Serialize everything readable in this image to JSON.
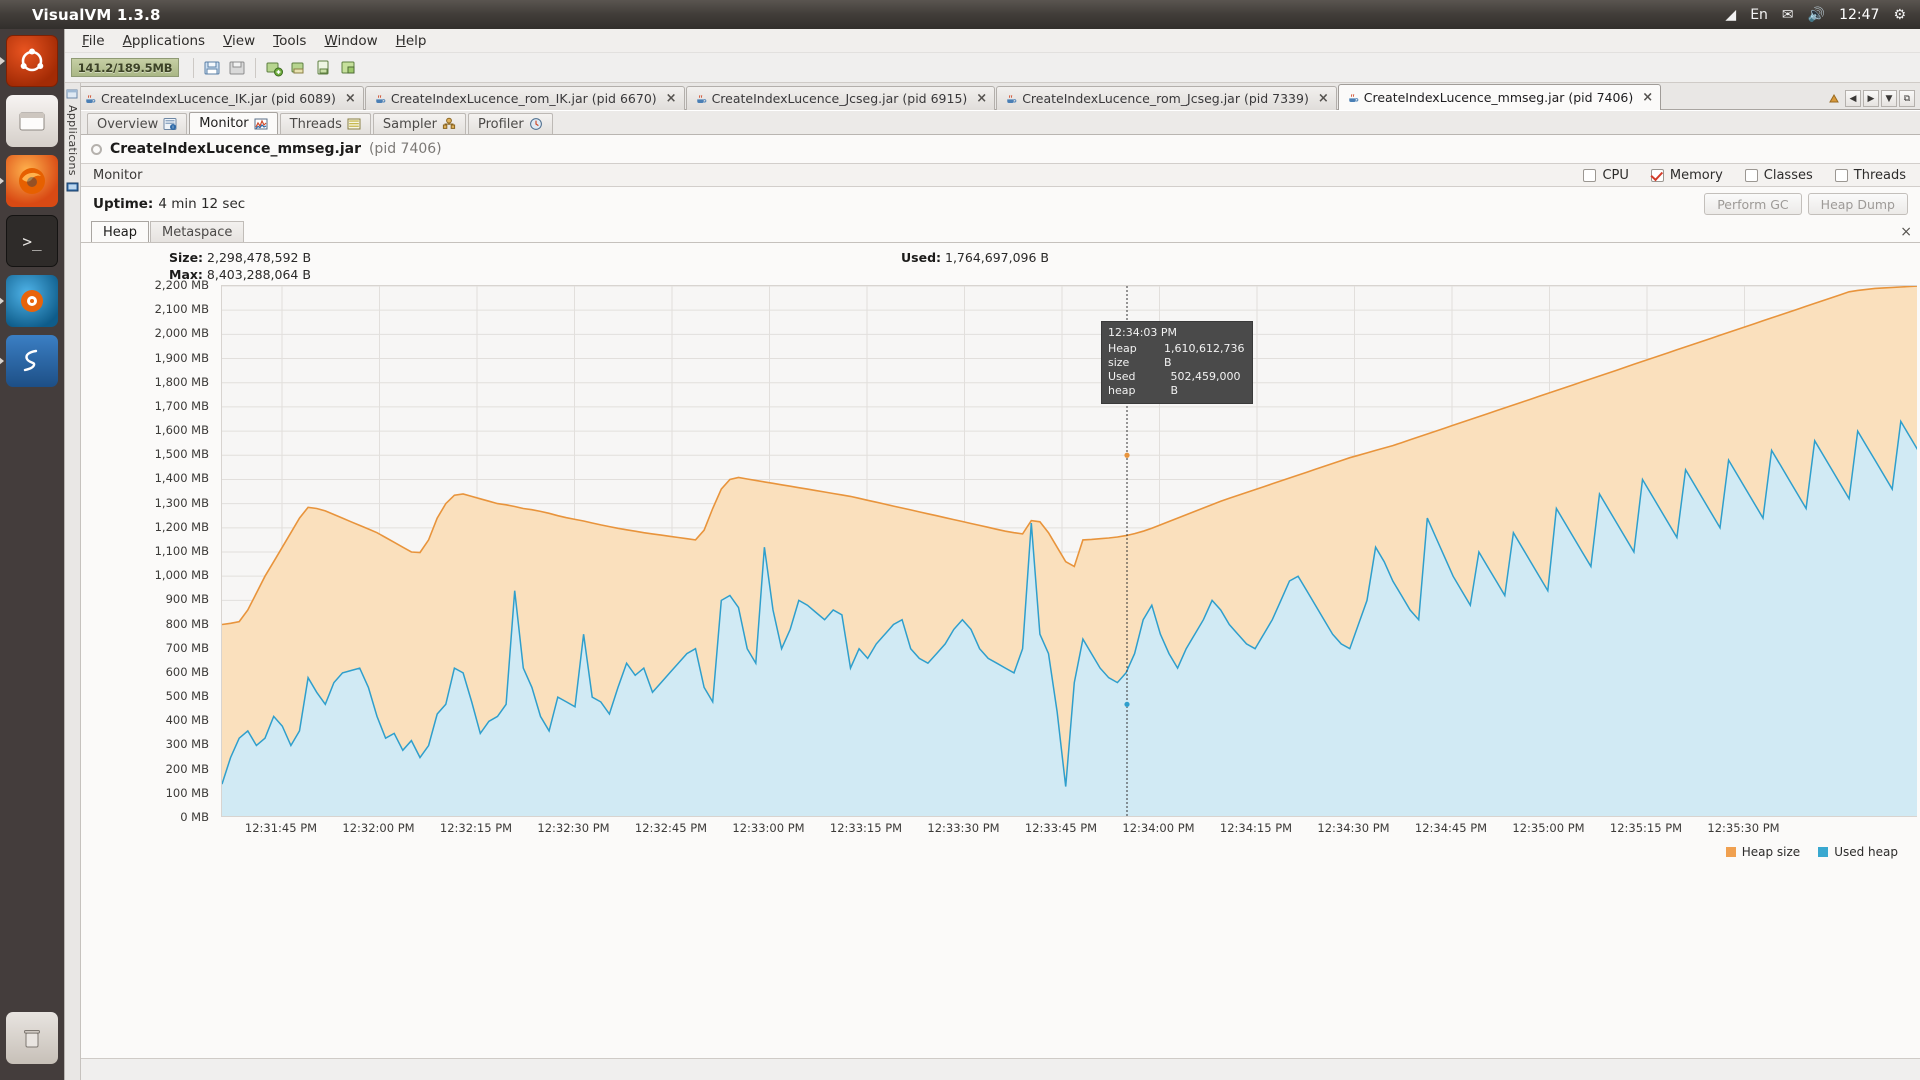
{
  "desktop": {
    "title": "VisualVM 1.3.8",
    "clock": "12:47",
    "indicators": [
      "wifi-icon",
      "En",
      "mail-icon",
      "volume-icon"
    ],
    "launcher": [
      {
        "name": "ubuntu-dash",
        "glyph": "●"
      },
      {
        "name": "files",
        "glyph": "▤"
      },
      {
        "name": "firefox",
        "glyph": "◑"
      },
      {
        "name": "terminal",
        "glyph": "$_"
      },
      {
        "name": "amarok",
        "glyph": "♫"
      },
      {
        "name": "java-app",
        "glyph": "☕"
      },
      {
        "name": "visualvm",
        "glyph": "S"
      },
      {
        "name": "trash",
        "glyph": "🗑"
      }
    ]
  },
  "menu": [
    {
      "label": "File",
      "mnemonic": "F"
    },
    {
      "label": "Applications",
      "mnemonic": "A"
    },
    {
      "label": "View",
      "mnemonic": "V"
    },
    {
      "label": "Tools",
      "mnemonic": "T"
    },
    {
      "label": "Window",
      "mnemonic": "W"
    },
    {
      "label": "Help",
      "mnemonic": "H"
    }
  ],
  "toolbar": {
    "heap_meter": "141.2/189.5MB",
    "buttons": [
      {
        "name": "open-file-button",
        "icon": "folder-open-icon"
      },
      {
        "name": "save-button",
        "icon": "floppy-icon"
      },
      {
        "name": "add-jmx-connection-button",
        "icon": "add-connection-icon"
      },
      {
        "name": "add-remote-host-button",
        "icon": "add-jmx-icon"
      },
      {
        "name": "add-snapshot-button",
        "icon": "add-snapshot-icon"
      },
      {
        "name": "add-app-button",
        "icon": "add-app-icon"
      }
    ]
  },
  "tabs": [
    {
      "label": "CreateIndexLucence_IK.jar (pid 6089)",
      "active": false,
      "closable": true
    },
    {
      "label": "CreateIndexLucence_rom_IK.jar (pid 6670)",
      "active": false,
      "closable": true
    },
    {
      "label": "CreateIndexLucence_Jcseg.jar (pid 6915)",
      "active": false,
      "closable": true
    },
    {
      "label": "CreateIndexLucence_rom_Jcseg.jar (pid 7339)",
      "active": false,
      "closable": true
    },
    {
      "label": "CreateIndexLucence_mmseg.jar (pid 7406)",
      "active": true,
      "closable": true
    }
  ],
  "tab_nav": {
    "scroll_left": "◀",
    "scroll_right": "▶",
    "dropdown": "▼",
    "maximize": "⧉"
  },
  "dock": {
    "label": "Applications",
    "icons": [
      "applications-window-icon",
      "monitor-icon"
    ]
  },
  "subtabs": [
    {
      "label": "Overview",
      "icon": "overview-icon",
      "active": false
    },
    {
      "label": "Monitor",
      "icon": "monitor-chart-icon",
      "active": true
    },
    {
      "label": "Threads",
      "icon": "threads-icon",
      "active": false
    },
    {
      "label": "Sampler",
      "icon": "sampler-icon",
      "active": false
    },
    {
      "label": "Profiler",
      "icon": "profiler-clock-icon",
      "active": false
    }
  ],
  "app_header": {
    "name": "CreateIndexLucence_mmseg.jar",
    "pid": "(pid 7406)"
  },
  "monitor_bar": {
    "title": "Monitor",
    "checkboxes": [
      {
        "label": "CPU",
        "checked": false
      },
      {
        "label": "Memory",
        "checked": true
      },
      {
        "label": "Classes",
        "checked": false
      },
      {
        "label": "Threads",
        "checked": false
      }
    ]
  },
  "uptime": {
    "label": "Uptime:",
    "value": "4 min 12 sec",
    "perform_gc": "Perform GC",
    "heap_dump": "Heap Dump"
  },
  "memory_tabs": [
    {
      "label": "Heap",
      "active": true
    },
    {
      "label": "Metaspace",
      "active": false
    }
  ],
  "memory_stats": {
    "size_label": "Size:",
    "size_value": "2,298,478,592 B",
    "max_label": "Max:",
    "max_value": "8,403,288,064 B",
    "used_label": "Used:",
    "used_value": "1,764,697,096 B"
  },
  "tooltip": {
    "time": "12:34:03 PM",
    "rows": [
      {
        "label": "Heap size",
        "value": "1,610,612,736 B"
      },
      {
        "label": "Used heap",
        "value": "502,459,000 B"
      }
    ]
  },
  "legend": [
    {
      "label": "Heap size",
      "color": "#f0a050"
    },
    {
      "label": "Used heap",
      "color": "#39a8d0"
    }
  ],
  "colors": {
    "heap_line": "#e8943c",
    "heap_fill": "#fae0bd",
    "used_line": "#2f9fcc",
    "used_fill": "#cfeaf7",
    "checkbox_check": "#d33c2a"
  },
  "chart_data": {
    "type": "area",
    "title": "Heap",
    "xlabel": "",
    "ylabel": "MB",
    "ylim": [
      0,
      2200
    ],
    "yticks": [
      0,
      100,
      200,
      300,
      400,
      500,
      600,
      700,
      800,
      900,
      1000,
      1100,
      1200,
      1300,
      1400,
      1500,
      1600,
      1700,
      1800,
      1900,
      2000,
      2100,
      2200
    ],
    "ytick_labels": [
      "0 MB",
      "100 MB",
      "200 MB",
      "300 MB",
      "400 MB",
      "500 MB",
      "600 MB",
      "700 MB",
      "800 MB",
      "900 MB",
      "1,000 MB",
      "1,100 MB",
      "1,200 MB",
      "1,300 MB",
      "1,400 MB",
      "1,500 MB",
      "1,600 MB",
      "1,700 MB",
      "1,800 MB",
      "1,900 MB",
      "2,000 MB",
      "2,100 MB",
      "2,200 MB"
    ],
    "xtick_labels": [
      "12:31:45 PM",
      "12:32:00 PM",
      "12:32:15 PM",
      "12:32:30 PM",
      "12:32:45 PM",
      "12:33:00 PM",
      "12:33:15 PM",
      "12:33:30 PM",
      "12:33:45 PM",
      "12:34:00 PM",
      "12:34:15 PM",
      "12:34:30 PM",
      "12:34:45 PM",
      "12:35:00 PM",
      "12:35:15 PM",
      "12:35:30 PM"
    ],
    "grid": true,
    "legend_position": "bottom-right",
    "marker_time": "12:34:03 PM",
    "series": [
      {
        "name": "Heap size",
        "color": "#e8943c",
        "values": [
          800,
          805,
          812,
          860,
          930,
          1000,
          1060,
          1120,
          1180,
          1240,
          1285,
          1280,
          1270,
          1255,
          1240,
          1225,
          1210,
          1195,
          1180,
          1160,
          1140,
          1120,
          1100,
          1098,
          1150,
          1240,
          1300,
          1335,
          1340,
          1330,
          1320,
          1310,
          1300,
          1295,
          1288,
          1280,
          1275,
          1268,
          1260,
          1250,
          1242,
          1235,
          1228,
          1220,
          1212,
          1205,
          1198,
          1192,
          1186,
          1180,
          1175,
          1170,
          1165,
          1160,
          1155,
          1150,
          1190,
          1280,
          1360,
          1400,
          1408,
          1402,
          1396,
          1390,
          1384,
          1378,
          1372,
          1366,
          1360,
          1354,
          1348,
          1342,
          1336,
          1330,
          1322,
          1314,
          1306,
          1298,
          1290,
          1282,
          1274,
          1266,
          1258,
          1250,
          1242,
          1234,
          1226,
          1218,
          1210,
          1202,
          1194,
          1186,
          1180,
          1175,
          1230,
          1225,
          1180,
          1120,
          1060,
          1040,
          1150,
          1152,
          1155,
          1158,
          1162,
          1168,
          1176,
          1186,
          1198,
          1212,
          1226,
          1240,
          1254,
          1268,
          1282,
          1296,
          1310,
          1322,
          1334,
          1346,
          1358,
          1370,
          1382,
          1394,
          1406,
          1418,
          1430,
          1442,
          1454,
          1466,
          1478,
          1490,
          1500,
          1510,
          1520,
          1530,
          1540,
          1552,
          1564,
          1576,
          1588,
          1600,
          1612,
          1624,
          1636,
          1648,
          1660,
          1672,
          1684,
          1696,
          1708,
          1720,
          1732,
          1744,
          1756,
          1768,
          1780,
          1792,
          1804,
          1816,
          1828,
          1840,
          1852,
          1864,
          1876,
          1888,
          1900,
          1912,
          1924,
          1936,
          1948,
          1960,
          1972,
          1984,
          1996,
          2008,
          2020,
          2032,
          2044,
          2056,
          2068,
          2080,
          2092,
          2104,
          2116,
          2128,
          2140,
          2152,
          2164,
          2176,
          2182,
          2186,
          2190,
          2192,
          2194,
          2196,
          2198,
          2200
        ]
      },
      {
        "name": "Used heap",
        "color": "#2f9fcc",
        "values": [
          140,
          250,
          330,
          360,
          300,
          330,
          420,
          380,
          300,
          360,
          580,
          520,
          470,
          560,
          600,
          610,
          620,
          540,
          420,
          330,
          350,
          280,
          320,
          250,
          300,
          430,
          470,
          620,
          600,
          480,
          350,
          400,
          420,
          470,
          940,
          620,
          540,
          420,
          360,
          500,
          480,
          460,
          760,
          500,
          480,
          430,
          540,
          640,
          590,
          620,
          520,
          560,
          600,
          640,
          680,
          700,
          540,
          480,
          900,
          920,
          870,
          700,
          640,
          1120,
          860,
          700,
          780,
          900,
          880,
          850,
          820,
          860,
          840,
          620,
          700,
          660,
          720,
          760,
          800,
          820,
          700,
          660,
          640,
          680,
          720,
          780,
          820,
          780,
          700,
          660,
          640,
          620,
          600,
          700,
          1220,
          760,
          680,
          440,
          130,
          560,
          740,
          680,
          620,
          580,
          560,
          600,
          680,
          820,
          880,
          760,
          680,
          620,
          700,
          760,
          820,
          900,
          860,
          800,
          760,
          720,
          700,
          760,
          820,
          900,
          980,
          1000,
          940,
          880,
          820,
          760,
          720,
          700,
          800,
          900,
          1120,
          1060,
          980,
          920,
          860,
          820,
          1240,
          1160,
          1080,
          1000,
          940,
          880,
          1100,
          1040,
          980,
          920,
          1180,
          1120,
          1060,
          1000,
          940,
          1280,
          1220,
          1160,
          1100,
          1040,
          1340,
          1280,
          1220,
          1160,
          1100,
          1400,
          1340,
          1280,
          1220,
          1160,
          1440,
          1380,
          1320,
          1260,
          1200,
          1480,
          1420,
          1360,
          1300,
          1240,
          1520,
          1460,
          1400,
          1340,
          1280,
          1560,
          1500,
          1440,
          1380,
          1320,
          1600,
          1540,
          1480,
          1420,
          1360,
          1640,
          1580,
          1520,
          1700
        ]
      }
    ]
  }
}
